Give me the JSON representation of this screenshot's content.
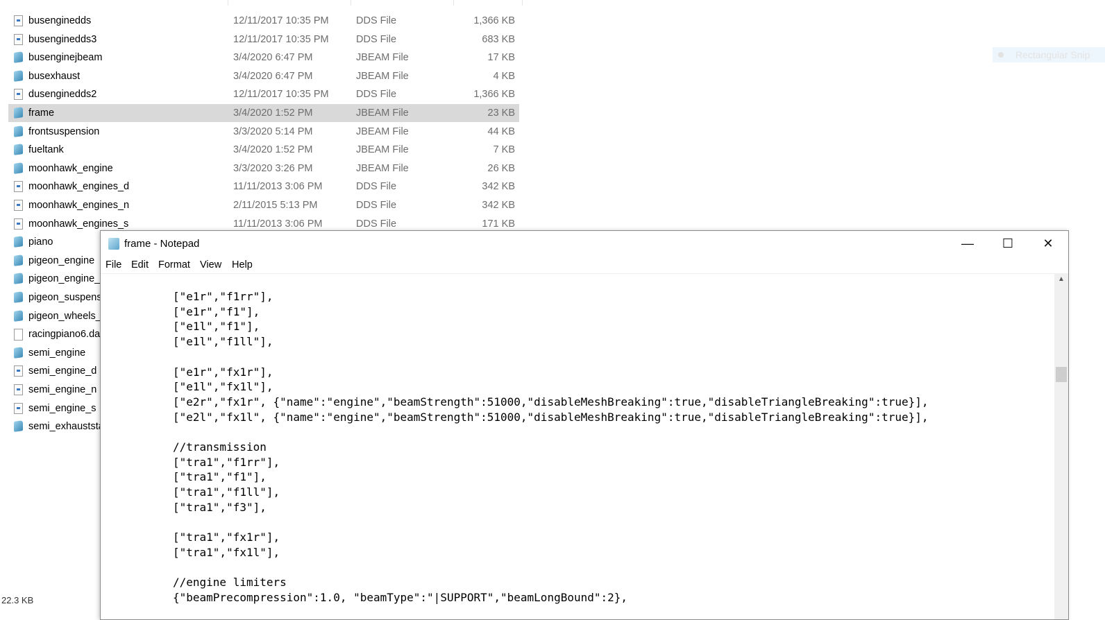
{
  "explorer": {
    "files": [
      {
        "name": "busenginedds",
        "date": "12/11/2017 10:35 PM",
        "type": "DDS File",
        "size": "1,366 KB",
        "icon": "dds-file-icon"
      },
      {
        "name": "busenginedds3",
        "date": "12/11/2017 10:35 PM",
        "type": "DDS File",
        "size": "683 KB",
        "icon": "dds-file-icon"
      },
      {
        "name": "busenginejbeam",
        "date": "3/4/2020 6:47 PM",
        "type": "JBEAM File",
        "size": "17 KB",
        "icon": "jbeam-file-icon"
      },
      {
        "name": "busexhaust",
        "date": "3/4/2020 6:47 PM",
        "type": "JBEAM File",
        "size": "4 KB",
        "icon": "jbeam-file-icon"
      },
      {
        "name": "dusenginedds2",
        "date": "12/11/2017 10:35 PM",
        "type": "DDS File",
        "size": "1,366 KB",
        "icon": "dds-file-icon"
      },
      {
        "name": "frame",
        "date": "3/4/2020 1:52 PM",
        "type": "JBEAM File",
        "size": "23 KB",
        "icon": "jbeam-file-icon",
        "selected": true
      },
      {
        "name": "frontsuspension",
        "date": "3/3/2020 5:14 PM",
        "type": "JBEAM File",
        "size": "44 KB",
        "icon": "jbeam-file-icon"
      },
      {
        "name": "fueltank",
        "date": "3/4/2020 1:52 PM",
        "type": "JBEAM File",
        "size": "7 KB",
        "icon": "jbeam-file-icon"
      },
      {
        "name": "moonhawk_engine",
        "date": "3/3/2020 3:26 PM",
        "type": "JBEAM File",
        "size": "26 KB",
        "icon": "jbeam-file-icon"
      },
      {
        "name": "moonhawk_engines_d",
        "date": "11/11/2013 3:06 PM",
        "type": "DDS File",
        "size": "342 KB",
        "icon": "dds-file-icon"
      },
      {
        "name": "moonhawk_engines_n",
        "date": "2/11/2015 5:13 PM",
        "type": "DDS File",
        "size": "342 KB",
        "icon": "dds-file-icon"
      },
      {
        "name": "moonhawk_engines_s",
        "date": "11/11/2013 3:06 PM",
        "type": "DDS File",
        "size": "171 KB",
        "icon": "dds-file-icon"
      },
      {
        "name": "piano",
        "icon": "jbeam-file-icon"
      },
      {
        "name": "pigeon_engine",
        "icon": "jbeam-file-icon"
      },
      {
        "name": "pigeon_engine_",
        "icon": "jbeam-file-icon"
      },
      {
        "name": "pigeon_suspens",
        "icon": "jbeam-file-icon"
      },
      {
        "name": "pigeon_wheels_",
        "icon": "jbeam-file-icon"
      },
      {
        "name": "racingpiano6.da",
        "icon": "blank-file-icon"
      },
      {
        "name": "semi_engine",
        "icon": "jbeam-file-icon"
      },
      {
        "name": "semi_engine_d",
        "icon": "dds-file-icon"
      },
      {
        "name": "semi_engine_n",
        "icon": "dds-file-icon"
      },
      {
        "name": "semi_engine_s",
        "icon": "dds-file-icon"
      },
      {
        "name": "semi_exhauststa",
        "icon": "jbeam-file-icon"
      }
    ],
    "status": "22.3 KB"
  },
  "snip": {
    "label": "Rectangular Snip"
  },
  "notepad": {
    "title": "frame - Notepad",
    "menu": [
      "File",
      "Edit",
      "Format",
      "View",
      "Help"
    ],
    "content": "[\"e1r\",\"f1rr\"],\n[\"e1r\",\"f1\"],\n[\"e1l\",\"f1\"],\n[\"e1l\",\"f1ll\"],\n\n[\"e1r\",\"fx1r\"],\n[\"e1l\",\"fx1l\"],\n[\"e2r\",\"fx1r\", {\"name\":\"engine\",\"beamStrength\":51000,\"disableMeshBreaking\":true,\"disableTriangleBreaking\":true}],\n[\"e2l\",\"fx1l\", {\"name\":\"engine\",\"beamStrength\":51000,\"disableMeshBreaking\":true,\"disableTriangleBreaking\":true}],\n\n//transmission\n[\"tra1\",\"f1rr\"],\n[\"tra1\",\"f1\"],\n[\"tra1\",\"f1ll\"],\n[\"tra1\",\"f3\"],\n\n[\"tra1\",\"fx1r\"],\n[\"tra1\",\"fx1l\"],\n\n//engine limiters\n{\"beamPrecompression\":1.0, \"beamType\":\"|SUPPORT\",\"beamLongBound\":2},",
    "minimize": "—",
    "maximize": "☐",
    "close": "✕"
  }
}
